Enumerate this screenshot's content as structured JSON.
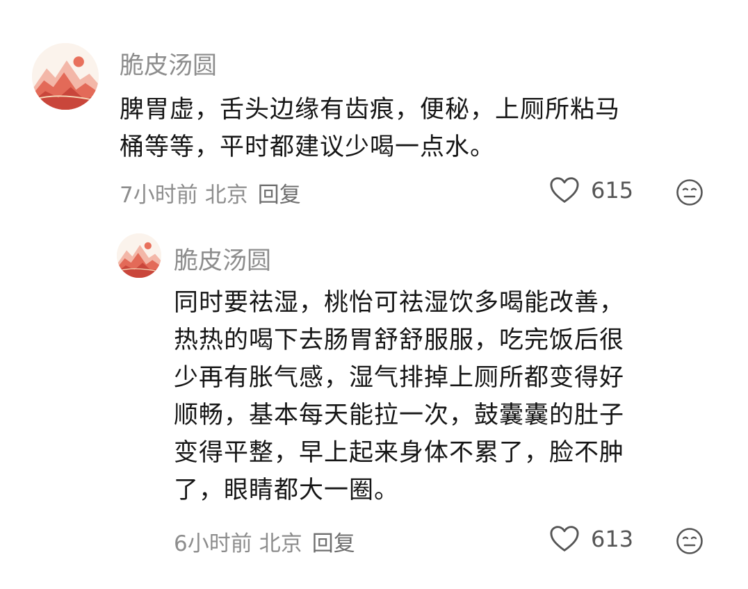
{
  "comments": [
    {
      "avatar_icon": "mountain-sunset-avatar-icon",
      "username": "脆皮汤圆",
      "lines": [
        "脾胃虚，舌头边缘有齿痕，便秘，上厕所粘马",
        "桶等等，平时都建议少喝一点水。"
      ],
      "time": "7小时前",
      "location": "北京",
      "reply_label": "回复",
      "likes": "615",
      "like_icon": "heart-outline-icon",
      "react_icon": "neutral-face-icon"
    },
    {
      "avatar_icon": "mountain-sunset-avatar-icon",
      "username": "脆皮汤圆",
      "lines": [
        "同时要祛湿，桃怡可祛湿饮多喝能改善，",
        "热热的喝下去肠胃舒舒服服，吃完饭后很",
        "少再有胀气感，湿气排掉上厕所都变得好",
        "顺畅，基本每天能拉一次，鼓囊囊的肚子",
        "变得平整，早上起来身体不累了，脸不肿",
        "了，眼睛都大一圈。"
      ],
      "time": "6小时前",
      "location": "北京",
      "reply_label": "回复",
      "likes": "613",
      "like_icon": "heart-outline-icon",
      "react_icon": "neutral-face-icon"
    }
  ],
  "colors": {
    "meta_gray": "#8d8d8d",
    "text": "#161616",
    "avatar_red": "#e0604f",
    "background": "#ffffff"
  }
}
